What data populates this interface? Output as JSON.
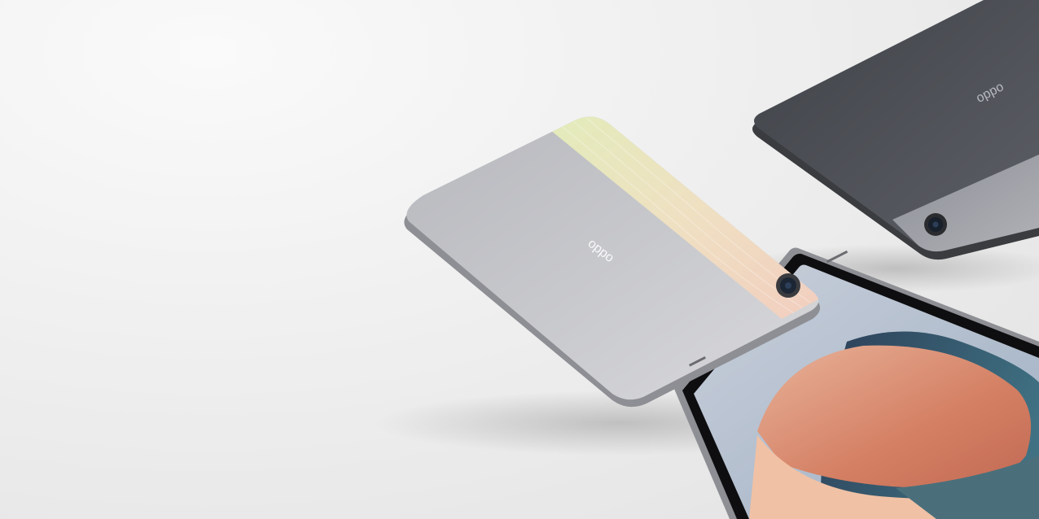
{
  "scene": {
    "background": "#eeeeee",
    "logo_text": "oppo",
    "silver_tablet": {
      "color": "#c4c5c9",
      "accent_gradient": [
        "#dfe9b8",
        "#f0dcc0",
        "#f3cfc0"
      ]
    },
    "dark_tablet": {
      "color": "#4a4d53",
      "accent_color": "#9ea0a6"
    },
    "front_tablet": {
      "bezel_color": "#0e0e10",
      "wallpaper_colors": [
        "#c7cdd9",
        "#2e4a66",
        "#d88467",
        "#f2c2a8",
        "#4a6e7a"
      ]
    }
  }
}
